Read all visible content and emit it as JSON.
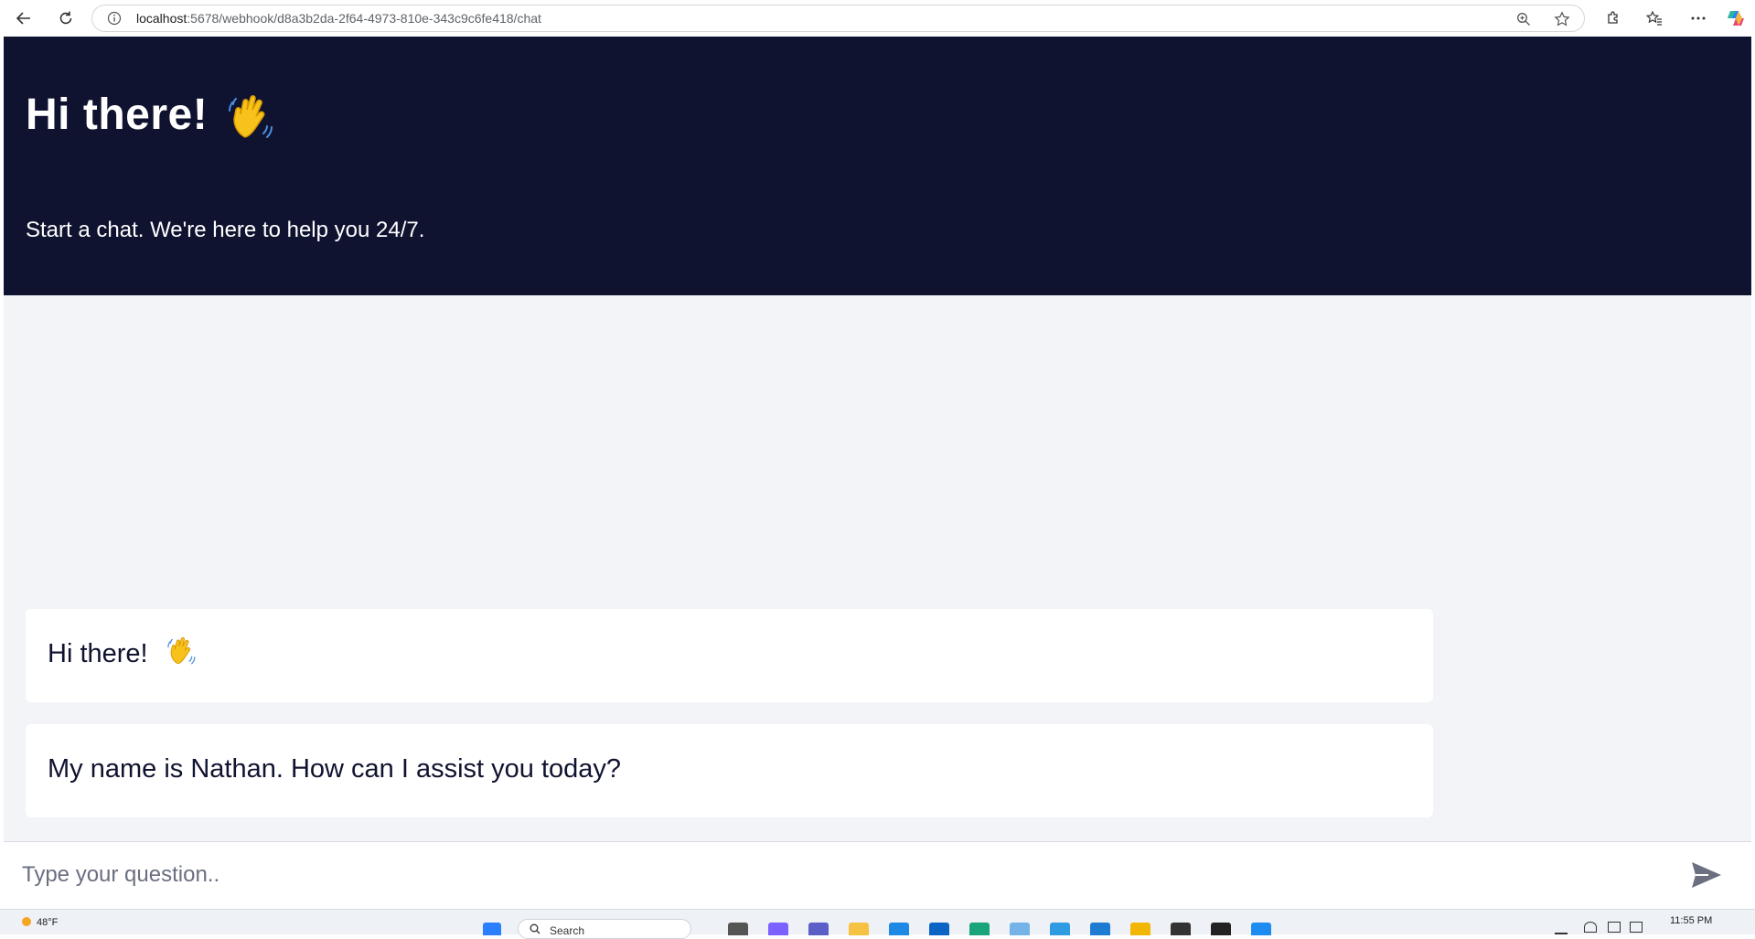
{
  "browser": {
    "url_host": "localhost",
    "url_path": ":5678/webhook/d8a3b2da-2f64-4973-810e-343c9c6fe418/chat",
    "icons": [
      "back-icon",
      "refresh-icon",
      "info-icon",
      "zoom-icon",
      "favorite-star-icon",
      "extensions-icon",
      "favorites-icon",
      "more-icon",
      "copilot-icon"
    ]
  },
  "header": {
    "title": "Hi there!",
    "title_emoji": "waving-hand",
    "subtitle": "Start a chat. We're here to help you 24/7."
  },
  "messages": [
    {
      "text": "Hi there!",
      "emoji": "waving-hand"
    },
    {
      "text": "My name is Nathan. How can I assist you today?"
    }
  ],
  "input": {
    "placeholder": "Type your question..",
    "value": ""
  },
  "taskbar": {
    "temperature": "48°F",
    "search_label": "Search",
    "time": "11:55 PM"
  },
  "colors": {
    "header_bg": "#101330",
    "chat_bg": "#f2f4f8",
    "message_bg": "#ffffff",
    "text_dark": "#101330",
    "send_icon": "#6b6f80"
  }
}
